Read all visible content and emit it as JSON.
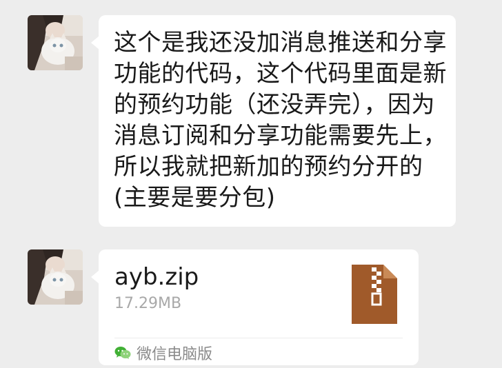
{
  "messages": [
    {
      "type": "text",
      "lines": [
        "这个是我还没加消息推送和分享",
        "功能的代码，这个代码里面是新",
        "的预约功能（还没弄完），因为",
        "消息订阅和分享功能需要先上，",
        "所以我就把新加的预约分开的",
        "(主要是要分包)"
      ]
    },
    {
      "type": "file",
      "file_name": "ayb.zip",
      "file_size": "17.29MB",
      "source_label": "微信电脑版"
    }
  ],
  "colors": {
    "background": "#ededed",
    "bubble": "#ffffff",
    "zip_icon": "#a05a2a",
    "wechat_green": "#41b035"
  }
}
